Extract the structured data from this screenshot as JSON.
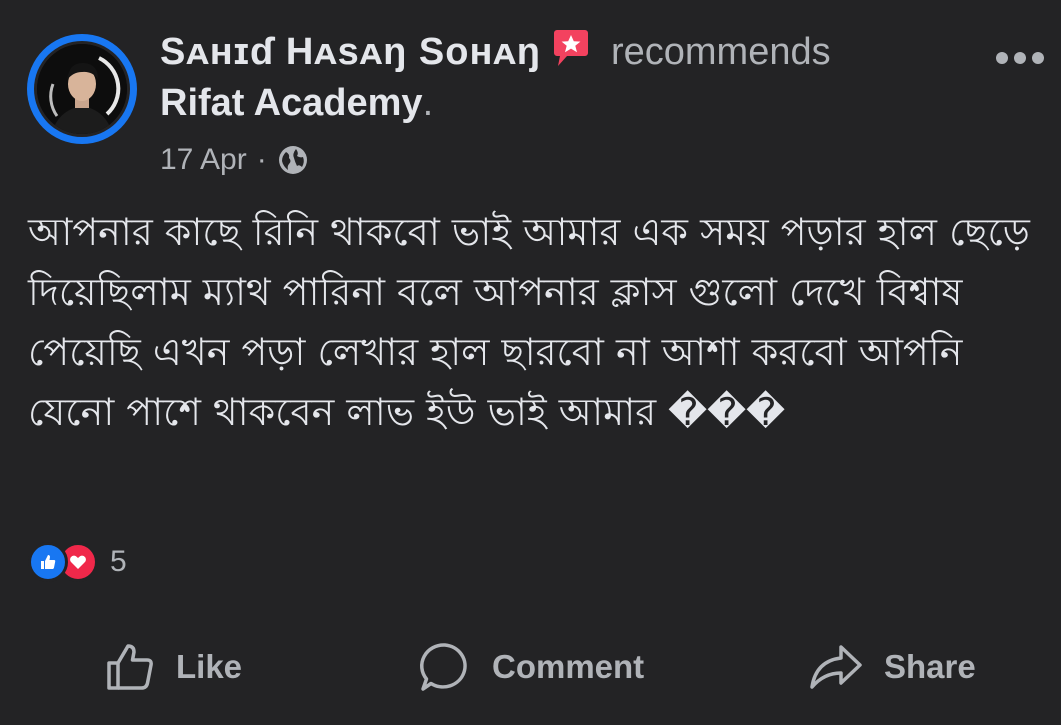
{
  "post": {
    "author_name": "Sᴀʜɪɗ Hᴀsᴀŋ Sᴏʜᴀŋ",
    "recommends_word": "recommends",
    "page_name": "Rifat Academy",
    "page_period": ".",
    "date": "17 Apr",
    "meta_separator": "·",
    "audience_icon": "globe-icon",
    "body_text": "আপনার কাছে রিনি থাকবো ভাই আমার এক সময় পড়ার হাল ছেড়ে দিয়েছিলাম ম্যাথ পারিনা বলে আপনার ক্লাস গুলো দেখে বিশ্বাষ পেয়েছি এখন পড়া লেখার হাল ছারবো না আশা করবো আপনি যেনো পাশে থাকবেন লাভ ইউ ভাই আমার ���"
  },
  "reactions": {
    "icons": [
      "like-reaction-icon",
      "love-reaction-icon"
    ],
    "count": "5"
  },
  "actions": {
    "like_label": "Like",
    "comment_label": "Comment",
    "share_label": "Share"
  },
  "colors": {
    "background": "#232325",
    "primary_text": "#e4e6eb",
    "secondary_text": "#b0b3b8",
    "accent_blue": "#1877f2",
    "love_red": "#f0284a"
  }
}
